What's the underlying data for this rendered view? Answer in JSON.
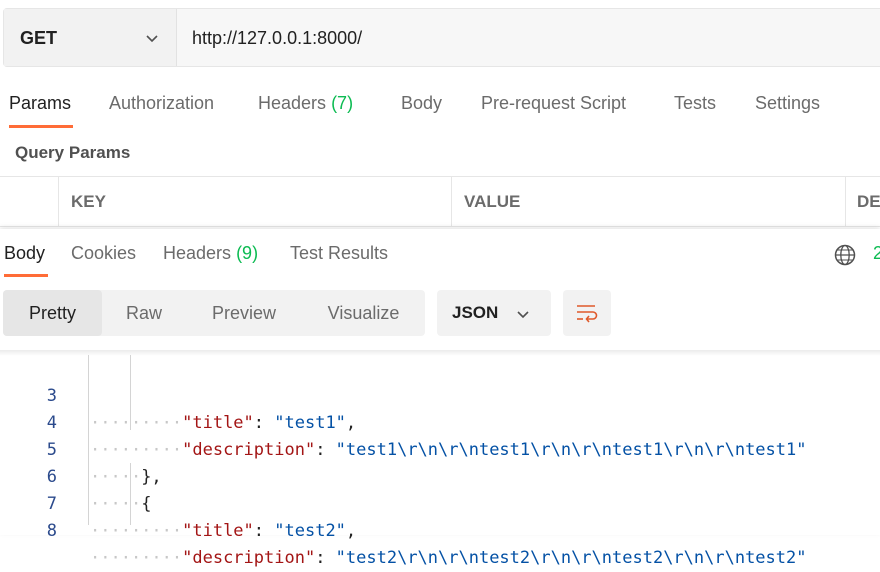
{
  "request": {
    "method": "GET",
    "url": "http://127.0.0.1:8000/"
  },
  "request_tabs": [
    {
      "label": "Params",
      "active": true
    },
    {
      "label": "Authorization"
    },
    {
      "label": "Headers",
      "count": "(7)"
    },
    {
      "label": "Body"
    },
    {
      "label": "Pre-request Script"
    },
    {
      "label": "Tests"
    },
    {
      "label": "Settings"
    }
  ],
  "query_params": {
    "title": "Query Params",
    "columns": [
      "KEY",
      "VALUE",
      "DE"
    ]
  },
  "response": {
    "tabs": [
      {
        "label": "Body",
        "active": true
      },
      {
        "label": "Cookies"
      },
      {
        "label": "Headers",
        "count": "(9)"
      },
      {
        "label": "Test Results"
      }
    ],
    "status_clip": "2",
    "view_modes": [
      "Pretty",
      "Raw",
      "Preview",
      "Visualize"
    ],
    "active_view": "Pretty",
    "format": "JSON"
  },
  "code": {
    "line_numbers": [
      "3",
      "4",
      "5",
      "6",
      "7",
      "8"
    ],
    "lines": [
      {
        "key": "\"title\"",
        "value": "\"test1\"",
        "end": ","
      },
      {
        "key": "\"description\"",
        "value": "\"test1\\r\\n\\r\\ntest1\\r\\n\\r\\ntest1\\r\\n\\r\\ntest1\""
      },
      {
        "punct": "},"
      },
      {
        "punct": "{"
      },
      {
        "key": "\"title\"",
        "value": "\"test2\"",
        "end": ","
      },
      {
        "key": "\"description\"",
        "value": "\"test2\\r\\n\\r\\ntest2\\r\\n\\r\\ntest2\\r\\n\\r\\ntest2\""
      }
    ]
  },
  "colors": {
    "accent": "#ff6c37",
    "count_green": "#0cbb52",
    "json_key": "#a31515",
    "json_string": "#0451a5"
  }
}
